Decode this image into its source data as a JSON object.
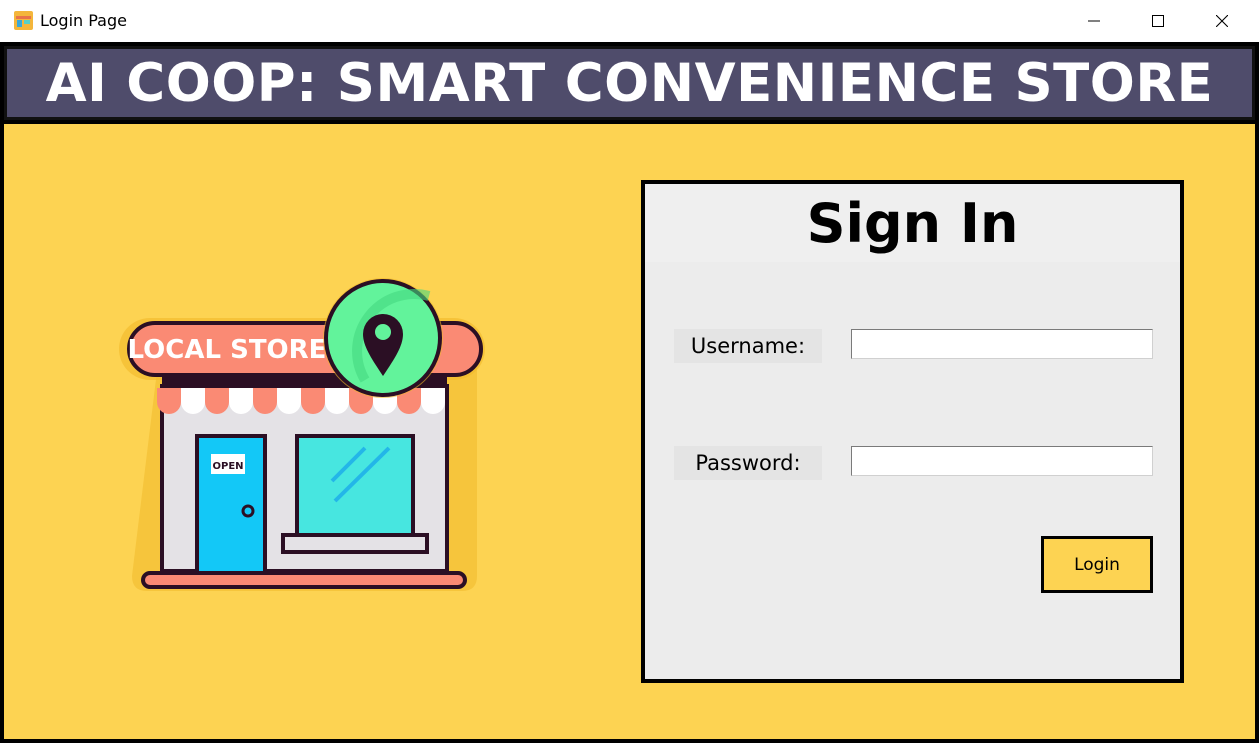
{
  "window": {
    "title": "Login Page",
    "icon": "app-icon",
    "controls": [
      "minimize-icon",
      "maximize-icon",
      "close-icon"
    ]
  },
  "header": {
    "title": "AI COOP: SMART CONVENIENCE STORE",
    "background": "#4f4c6b"
  },
  "illustration": {
    "sign_text": "LOCAL STORE",
    "door_sign": "OPEN",
    "icon": "location-pin-icon"
  },
  "signin": {
    "title": "Sign In",
    "username_label": "Username:",
    "username_value": "",
    "password_label": "Password:",
    "password_value": "",
    "login_label": "Login"
  },
  "colors": {
    "background": "#fdd352",
    "panel": "#ececec",
    "accent": "#fdd352"
  }
}
